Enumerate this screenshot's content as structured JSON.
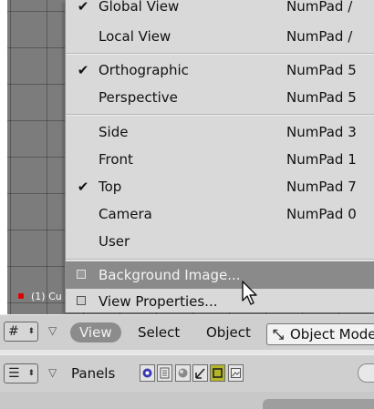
{
  "viewport": {
    "object_label": "(1) Cu"
  },
  "view_menu": {
    "items": [
      {
        "label": "Global View",
        "shortcut": "NumPad /",
        "checked": false
      },
      {
        "label": "Local View",
        "shortcut": "NumPad /",
        "checked": false
      },
      {
        "label": "Orthographic",
        "shortcut": "NumPad 5",
        "checked": true
      },
      {
        "label": "Perspective",
        "shortcut": "NumPad 5",
        "checked": false
      },
      {
        "label": "Side",
        "shortcut": "NumPad 3",
        "checked": false
      },
      {
        "label": "Front",
        "shortcut": "NumPad 1",
        "checked": false
      },
      {
        "label": "Top",
        "shortcut": "NumPad 7",
        "checked": true
      },
      {
        "label": "Camera",
        "shortcut": "NumPad 0",
        "checked": false
      },
      {
        "label": "User",
        "shortcut": "",
        "checked": false
      },
      {
        "label": "Background Image...",
        "toggle": true,
        "highlighted": true
      },
      {
        "label": "View Properties...",
        "toggle": true,
        "highlighted": false
      }
    ],
    "check_glyph": "✔"
  },
  "header_3d": {
    "window_type_icon": "grid-icon",
    "menus": [
      "View",
      "Select",
      "Object"
    ],
    "active_menu": "View",
    "mode_button": {
      "label": "Object Mode",
      "icon": "object-mode-icon"
    }
  },
  "header_buttons": {
    "window_type_icon": "buttons-window-icon",
    "panels_label": "Panels"
  },
  "colors": {
    "menu_bg": "#d9d9d9",
    "menu_highlight": "#8a8a8a",
    "viewport_bg": "#7c7c7c",
    "header_bg": "#cfcfcf"
  }
}
